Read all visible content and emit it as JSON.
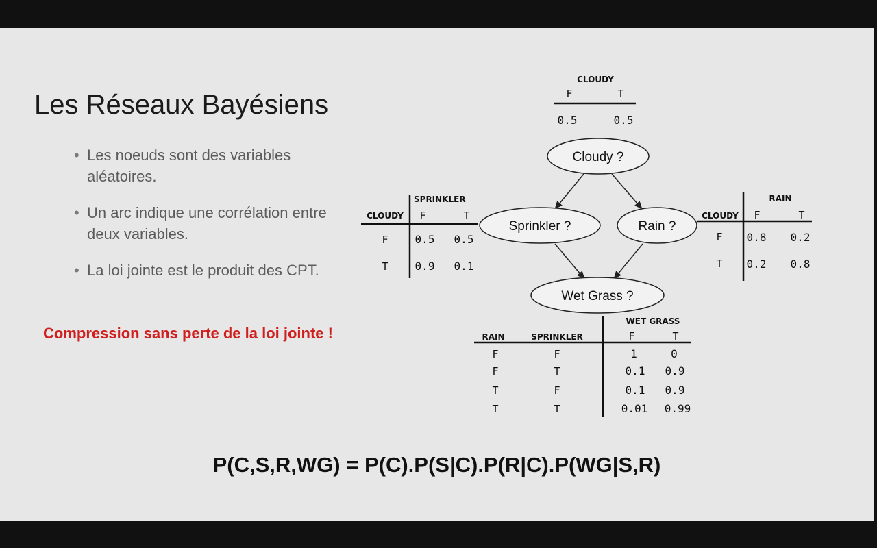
{
  "slide": {
    "title": "Les Réseaux Bayésiens",
    "bullets": [
      "Les noeuds sont des variables aléatoires.",
      "Un arc indique une corrélation entre deux variables.",
      "La loi jointe est le produit des CPT."
    ],
    "highlight": "Compression sans perte de la loi jointe !",
    "formula": "P(C,S,R,WG) = P(C).P(S|C).P(R|C).P(WG|S,R)"
  },
  "network": {
    "nodes": {
      "cloudy": "Cloudy ?",
      "sprinkler": "Sprinkler ?",
      "rain": "Rain ?",
      "wetgrass": "Wet Grass ?"
    },
    "cpt_cloudy": {
      "title": "CLOUDY",
      "cols": [
        "F",
        "T"
      ],
      "values": [
        "0.5",
        "0.5"
      ]
    },
    "cpt_sprinkler": {
      "title": "SPRINKLER",
      "parent": "CLOUDY",
      "cols": [
        "F",
        "T"
      ],
      "rows": [
        {
          "label": "F",
          "values": [
            "0.5",
            "0.5"
          ]
        },
        {
          "label": "T",
          "values": [
            "0.9",
            "0.1"
          ]
        }
      ]
    },
    "cpt_rain": {
      "title": "RAIN",
      "parent": "CLOUDY",
      "cols": [
        "F",
        "T"
      ],
      "rows": [
        {
          "label": "F",
          "values": [
            "0.8",
            "0.2"
          ]
        },
        {
          "label": "T",
          "values": [
            "0.2",
            "0.8"
          ]
        }
      ]
    },
    "cpt_wetgrass": {
      "title": "WET GRASS",
      "parents": [
        "RAIN",
        "SPRINKLER"
      ],
      "cols": [
        "F",
        "T"
      ],
      "rows": [
        {
          "labels": [
            "F",
            "F"
          ],
          "values": [
            "1",
            "0"
          ]
        },
        {
          "labels": [
            "F",
            "T"
          ],
          "values": [
            "0.1",
            "0.9"
          ]
        },
        {
          "labels": [
            "T",
            "F"
          ],
          "values": [
            "0.1",
            "0.9"
          ]
        },
        {
          "labels": [
            "T",
            "T"
          ],
          "values": [
            "0.01",
            "0.99"
          ]
        }
      ]
    }
  }
}
